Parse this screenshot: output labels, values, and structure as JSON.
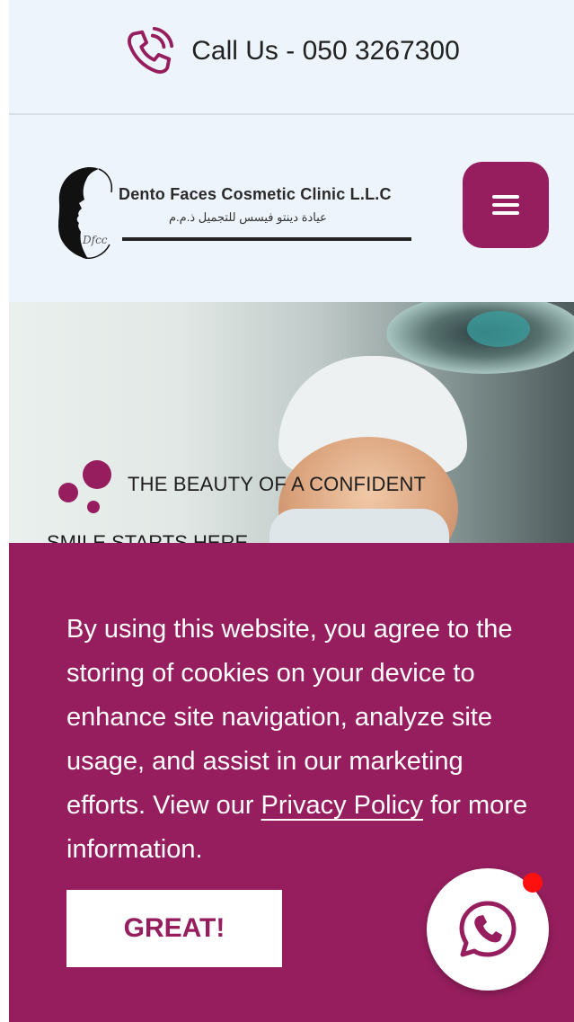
{
  "topbar": {
    "call_label": "Call Us - 050 3267300"
  },
  "logo": {
    "name_en": "Dento Faces Cosmetic Clinic L.L.C",
    "name_ar": "عيادة دينتو فيسس للتجميل ذ.م.م",
    "signature": "Dfcc"
  },
  "hero": {
    "tagline_line1": "THE BEAUTY OF A CONFIDENT",
    "tagline_line2": "SMILE STARTS HERE"
  },
  "cookie": {
    "text_before": "By using this website, you agree to the storing of cookies on your device to enhance site navigation, analyze site usage, and assist in our marketing efforts. View our ",
    "policy_link": "Privacy Policy",
    "text_after": " for more information.",
    "button_label": "GREAT!"
  },
  "icons": {
    "phone": "phone-ringing-icon",
    "menu": "hamburger-menu-icon",
    "whatsapp": "whatsapp-icon"
  },
  "colors": {
    "brand": "#961e5e",
    "page_bg": "#eef4fb",
    "notification": "#ff1010"
  }
}
